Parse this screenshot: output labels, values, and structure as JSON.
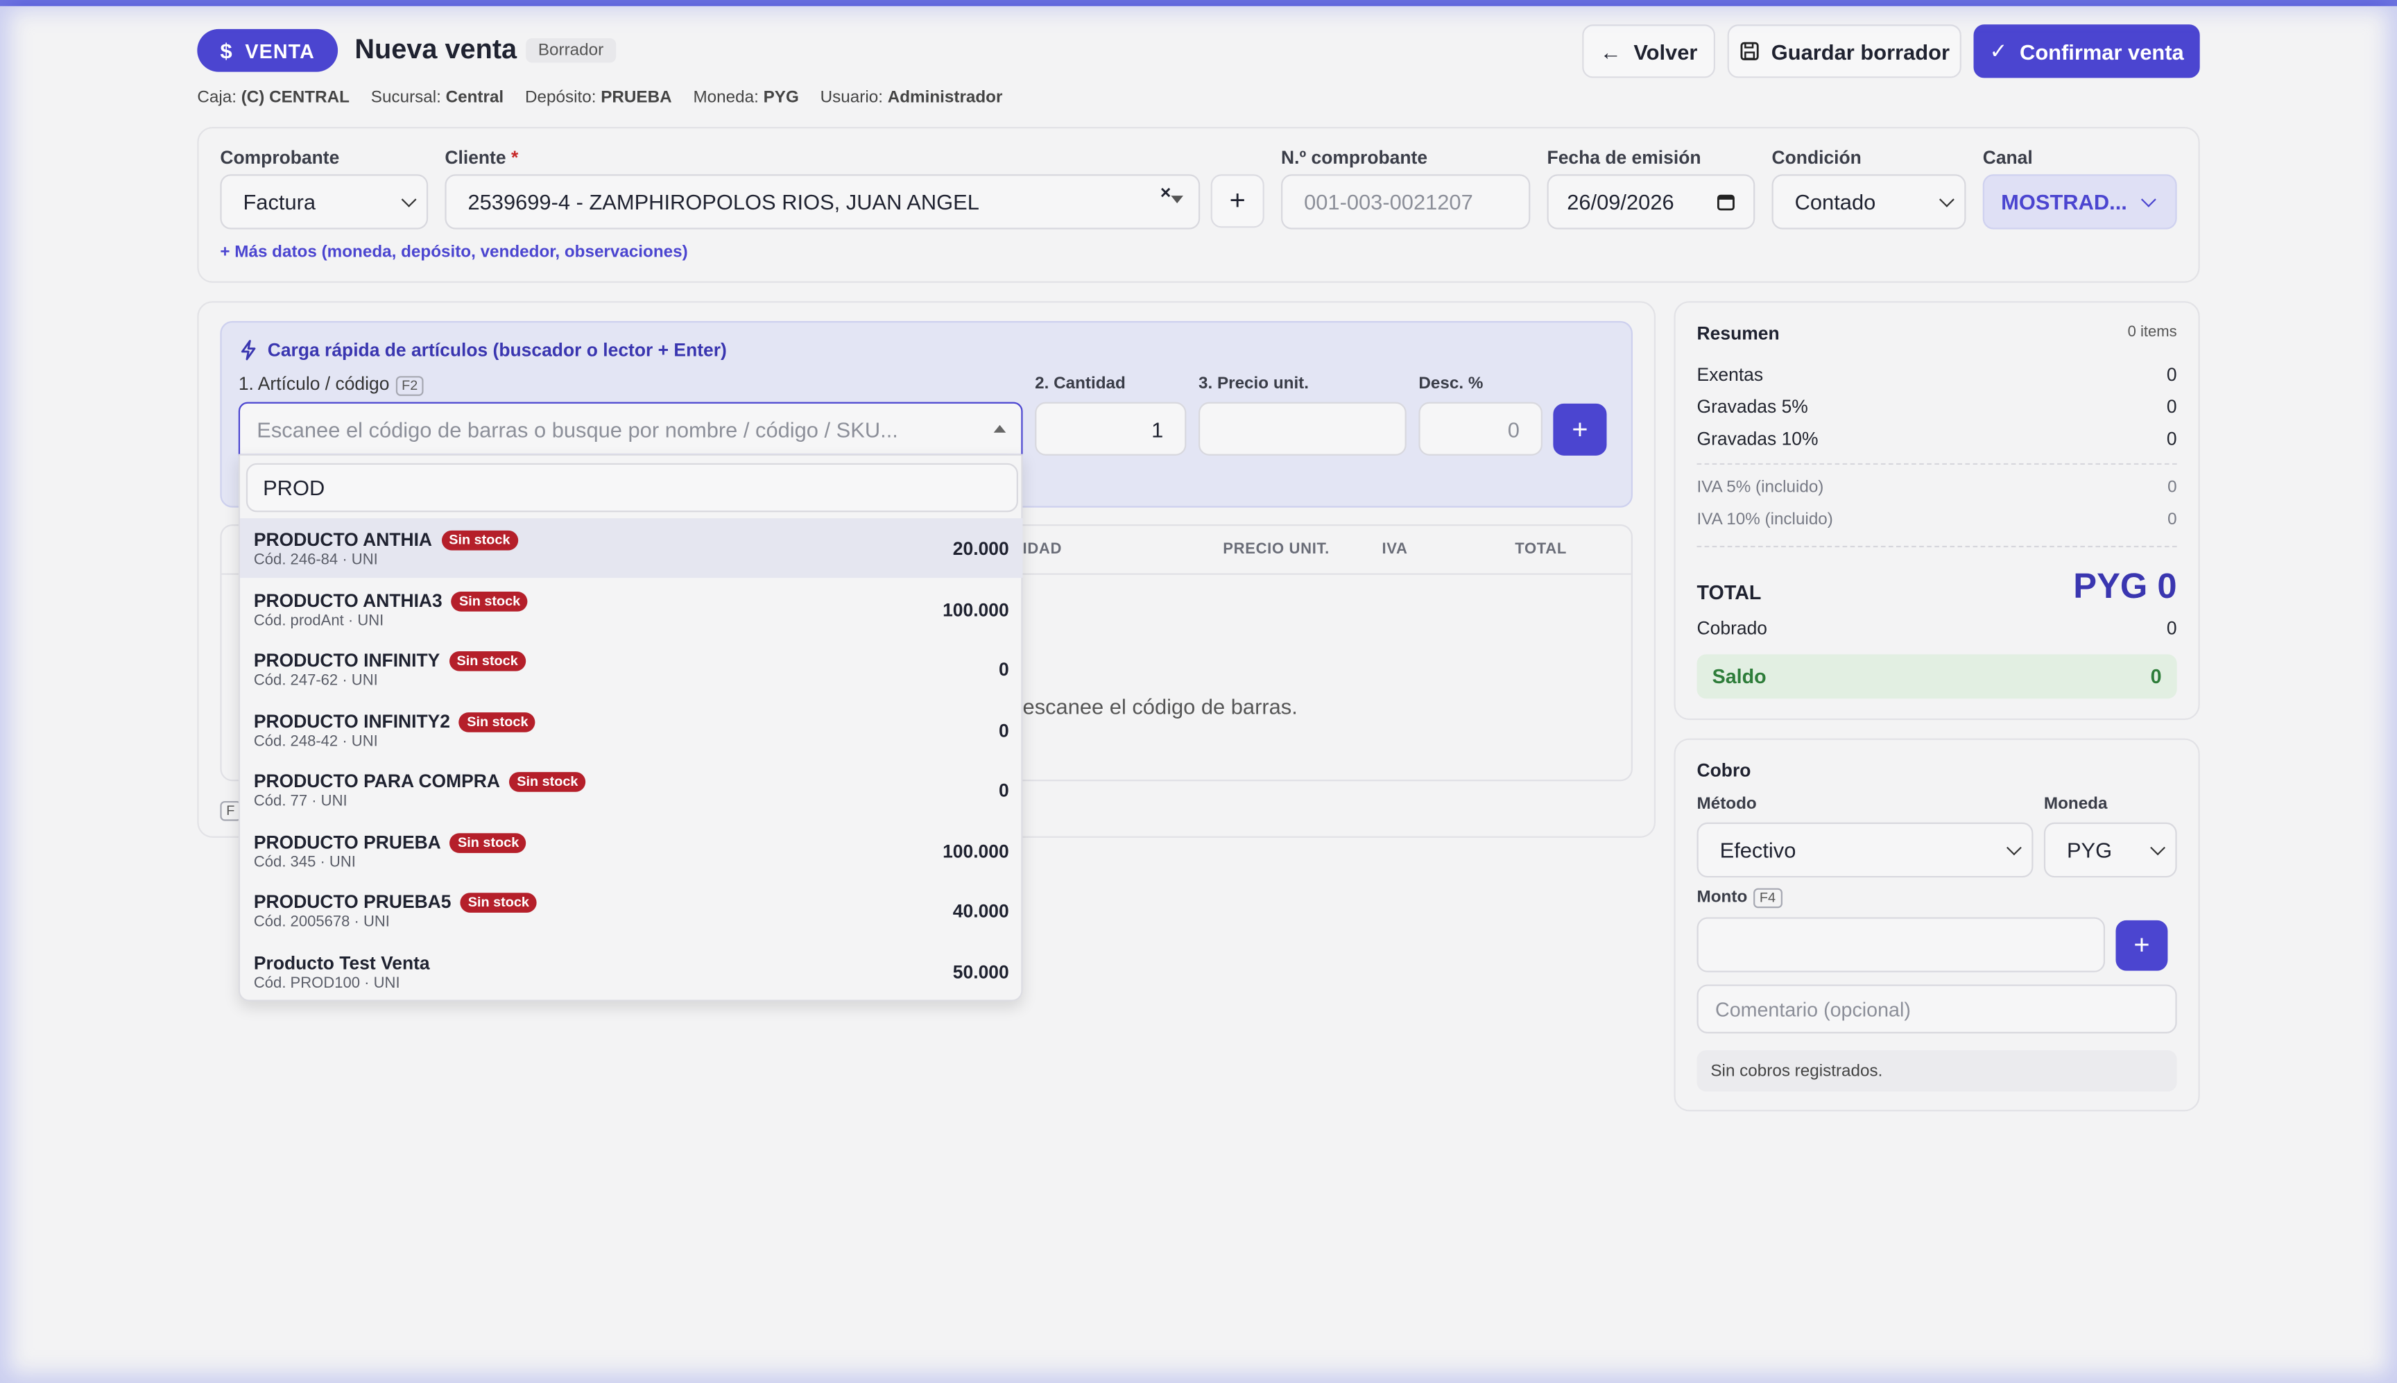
{
  "header": {
    "badge": "VENTA",
    "title": "Nueva venta",
    "status": "Borrador",
    "back_label": "Volver",
    "draft_label": "Guardar borrador",
    "confirm_label": "Confirmar venta"
  },
  "meta": [
    {
      "key": "Caja:",
      "value": "(C) CENTRAL"
    },
    {
      "key": "Sucursal:",
      "value": "Central"
    },
    {
      "key": "Depósito:",
      "value": "PRUEBA"
    },
    {
      "key": "Moneda:",
      "value": "PYG"
    },
    {
      "key": "Usuario:",
      "value": "Administrador"
    }
  ],
  "form": {
    "comprobante_label": "Comprobante",
    "comprobante_value": "Factura",
    "cliente_label": "Cliente",
    "required_mark": "*",
    "cliente_value": "2539699-4 - ZAMPHIROPOLOS RIOS, JUAN ANGEL",
    "numero_label": "N.º comprobante",
    "numero_placeholder": "001-003-0021207",
    "fecha_label": "Fecha de emisión",
    "fecha_value": "26/09/2026",
    "condicion_label": "Condición",
    "condicion_value": "Contado",
    "canal_label": "Canal",
    "canal_value": "MOSTRAD...",
    "more_link": "+ Más datos (moneda, depósito, vendedor, observaciones)"
  },
  "quick": {
    "title": "Carga rápida de artículos (buscador o lector + Enter)",
    "articulo_label": "1. Artículo / código",
    "articulo_key": "F2",
    "articulo_placeholder": "Escanee el código de barras o busque por nombre / código / SKU...",
    "cantidad_label": "2. Cantidad",
    "cantidad_value": "1",
    "precio_label": "3. Precio unit.",
    "desc_label": "Desc. %",
    "desc_value": "0",
    "search_text": "PROD"
  },
  "dropdown": [
    {
      "name": "PRODUCTO ANTHIA",
      "stock": "Sin stock",
      "code": "Cód. 246-84 · UNI",
      "price": "20.000"
    },
    {
      "name": "PRODUCTO ANTHIA3",
      "stock": "Sin stock",
      "code": "Cód. prodAnt · UNI",
      "price": "100.000"
    },
    {
      "name": "PRODUCTO INFINITY",
      "stock": "Sin stock",
      "code": "Cód. 247-62 · UNI",
      "price": "0"
    },
    {
      "name": "PRODUCTO INFINITY2",
      "stock": "Sin stock",
      "code": "Cód. 248-42 · UNI",
      "price": "0"
    },
    {
      "name": "PRODUCTO PARA COMPRA",
      "stock": "Sin stock",
      "code": "Cód. 77 · UNI",
      "price": "0"
    },
    {
      "name": "PRODUCTO PRUEBA",
      "stock": "Sin stock",
      "code": "Cód. 345 · UNI",
      "price": "100.000"
    },
    {
      "name": "PRODUCTO PRUEBA5",
      "stock": "Sin stock",
      "code": "Cód. 2005678 · UNI",
      "price": "40.000"
    },
    {
      "name": "Producto Test Venta",
      "stock": "",
      "code": "Cód. PROD100 · UNI",
      "price": "50.000"
    }
  ],
  "table": {
    "col_unidad": "IDAD",
    "col_precio": "PRECIO UNIT.",
    "col_iva": "IVA",
    "col_total": "TOTAL",
    "empty_text": "escanee el código de barras.",
    "footer_key": "F"
  },
  "summary": {
    "title": "Resumen",
    "items": "0 items",
    "exentas_label": "Exentas",
    "exentas": "0",
    "g5_label": "Gravadas 5%",
    "g5": "0",
    "g10_label": "Gravadas 10%",
    "g10": "0",
    "iva5_label": "IVA 5% (incluido)",
    "iva5": "0",
    "iva10_label": "IVA 10% (incluido)",
    "iva10": "0",
    "total_label": "TOTAL",
    "total": "PYG 0",
    "cobrado_label": "Cobrado",
    "cobrado": "0",
    "saldo_label": "Saldo",
    "saldo": "0"
  },
  "cobro": {
    "title": "Cobro",
    "metodo_label": "Método",
    "metodo_value": "Efectivo",
    "moneda_label": "Moneda",
    "moneda_value": "PYG",
    "monto_label": "Monto",
    "monto_key": "F4",
    "comment_placeholder": "Comentario (opcional)",
    "empty": "Sin cobros registrados."
  },
  "colors": {
    "accent": "#4b45d0",
    "danger": "#b51f2a",
    "success": "#2e7d3a"
  }
}
